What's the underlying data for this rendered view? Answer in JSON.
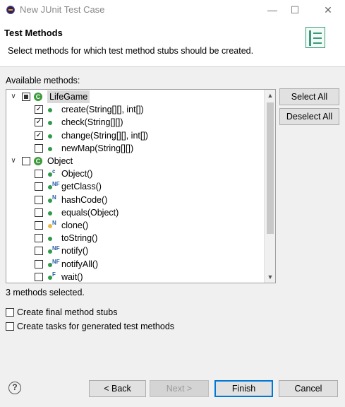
{
  "window": {
    "title": "New JUnit Test Case",
    "minimize": "—",
    "maximize": "☐",
    "close": "✕"
  },
  "header": {
    "title": "Test Methods",
    "description": "Select methods for which test method stubs should be created."
  },
  "available_label": "Available methods:",
  "tree": [
    {
      "kind": "class",
      "label": "LifeGame",
      "check": "partial",
      "expanded": true,
      "selected": true
    },
    {
      "kind": "method",
      "label": "create(String[][], int[])",
      "check": "checked",
      "marker": ""
    },
    {
      "kind": "method",
      "label": "check(String[][])",
      "check": "checked",
      "marker": ""
    },
    {
      "kind": "method",
      "label": "change(String[][], int[])",
      "check": "checked",
      "marker": ""
    },
    {
      "kind": "method",
      "label": "newMap(String[][])",
      "check": "unchecked",
      "marker": ""
    },
    {
      "kind": "class",
      "label": "Object",
      "check": "unchecked",
      "expanded": true,
      "selected": false
    },
    {
      "kind": "method",
      "label": "Object()",
      "check": "unchecked",
      "marker": "c"
    },
    {
      "kind": "method",
      "label": "getClass()",
      "check": "unchecked",
      "marker": "NF"
    },
    {
      "kind": "method",
      "label": "hashCode()",
      "check": "unchecked",
      "marker": "N"
    },
    {
      "kind": "method",
      "label": "equals(Object)",
      "check": "unchecked",
      "marker": ""
    },
    {
      "kind": "method",
      "label": "clone()",
      "check": "unchecked",
      "marker": "N",
      "protected": true
    },
    {
      "kind": "method",
      "label": "toString()",
      "check": "unchecked",
      "marker": ""
    },
    {
      "kind": "method",
      "label": "notify()",
      "check": "unchecked",
      "marker": "NF"
    },
    {
      "kind": "method",
      "label": "notifyAll()",
      "check": "unchecked",
      "marker": "NF"
    },
    {
      "kind": "method",
      "label": "wait()",
      "check": "unchecked",
      "marker": "F"
    }
  ],
  "buttons": {
    "select_all": "Select All",
    "deselect_all": "Deselect All"
  },
  "selection_status": "3 methods selected.",
  "options": [
    {
      "label": "Create final method stubs",
      "checked": false
    },
    {
      "label": "Create tasks for generated test methods",
      "checked": false
    }
  ],
  "footer": {
    "help": "?",
    "back": "< Back",
    "next": "Next >",
    "finish": "Finish",
    "cancel": "Cancel"
  },
  "colors": {
    "class_icon": "#3c9a3c",
    "method_icon": "#2e9a4a",
    "default_button_border": "#0078d7"
  }
}
